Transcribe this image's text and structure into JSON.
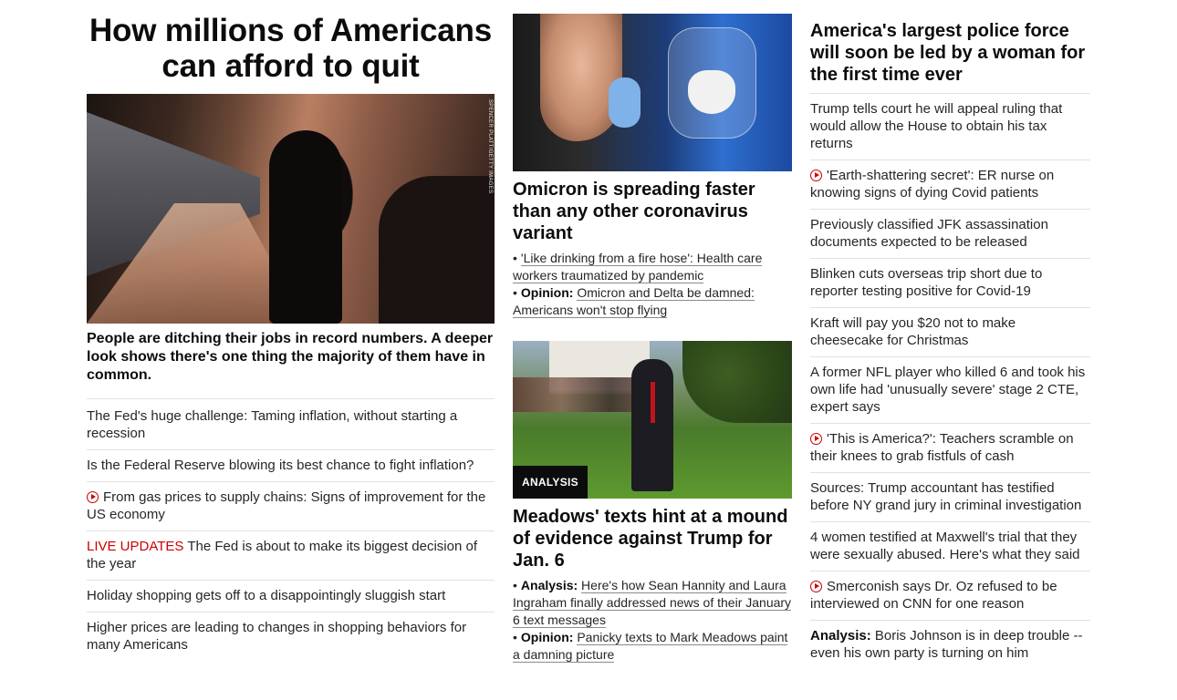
{
  "lead": {
    "headline": "How millions of Americans can afford to quit",
    "photo_credit": "SPENCER PLATT/GETTY IMAGES",
    "subhead": "People are ditching their jobs in record numbers. A deeper look shows there's one thing the majority of them have in common.",
    "related": [
      {
        "text": "The Fed's huge challenge: Taming inflation, without starting a recession"
      },
      {
        "text": "Is the Federal Reserve blowing its best chance to fight inflation?"
      },
      {
        "text": "From gas prices to supply chains: Signs of improvement for the US economy",
        "icon": "play-icon"
      },
      {
        "prefix": "LIVE UPDATES",
        "text": "The Fed is about to make its biggest decision of the year"
      },
      {
        "text": "Holiday shopping gets off to a disappointingly sluggish start"
      },
      {
        "text": "Higher prices are leading to changes in shopping behaviors for many Americans"
      }
    ]
  },
  "omicron": {
    "headline": "Omicron is spreading faster than any other coronavirus variant",
    "bullets": [
      {
        "label": "",
        "text": "'Like drinking from a fire hose': Health care workers traumatized by pandemic"
      },
      {
        "label": "Opinion:",
        "text": "Omicron and Delta be damned: Americans won't stop flying"
      }
    ]
  },
  "meadows": {
    "tag": "ANALYSIS",
    "headline": "Meadows' texts hint at a mound of evidence against Trump for Jan. 6",
    "bullets": [
      {
        "label": "Analysis:",
        "text": "Here's how Sean Hannity and Laura Ingraham finally addressed news of their January 6 text messages"
      },
      {
        "label": "Opinion:",
        "text": "Panicky texts to Mark Meadows paint a damning picture"
      }
    ]
  },
  "right": {
    "headline": "America's largest police force will soon be led by a woman for the first time ever",
    "items": [
      {
        "text": "Trump tells court he will appeal ruling that would allow the House to obtain his tax returns"
      },
      {
        "text": "'Earth-shattering secret': ER nurse on knowing signs of dying Covid patients",
        "icon": "play-icon"
      },
      {
        "text": "Previously classified JFK assassination documents expected to be released"
      },
      {
        "text": "Blinken cuts overseas trip short due to reporter testing positive for Covid-19"
      },
      {
        "text": "Kraft will pay you $20 not to make cheesecake for Christmas"
      },
      {
        "text": "A former NFL player who killed 6 and took his own life had 'unusually severe' stage 2 CTE, expert says"
      },
      {
        "text": "'This is America?': Teachers scramble on their knees to grab fistfuls of cash",
        "icon": "play-icon"
      },
      {
        "text": "Sources: Trump accountant has testified before NY grand jury in criminal investigation"
      },
      {
        "text": "4 women testified at Maxwell's trial that they were sexually abused. Here's what they said"
      },
      {
        "text": "Smerconish says Dr. Oz refused to be interviewed on CNN for one reason",
        "icon": "play-icon"
      },
      {
        "label": "Analysis:",
        "text": "Boris Johnson is in deep trouble -- even his own party is turning on him"
      }
    ]
  },
  "colors": {
    "live": "#cc0000",
    "play_icon": "#cc0000",
    "tag_bg": "#0c0c0c",
    "divider": "#e1e1e1"
  }
}
